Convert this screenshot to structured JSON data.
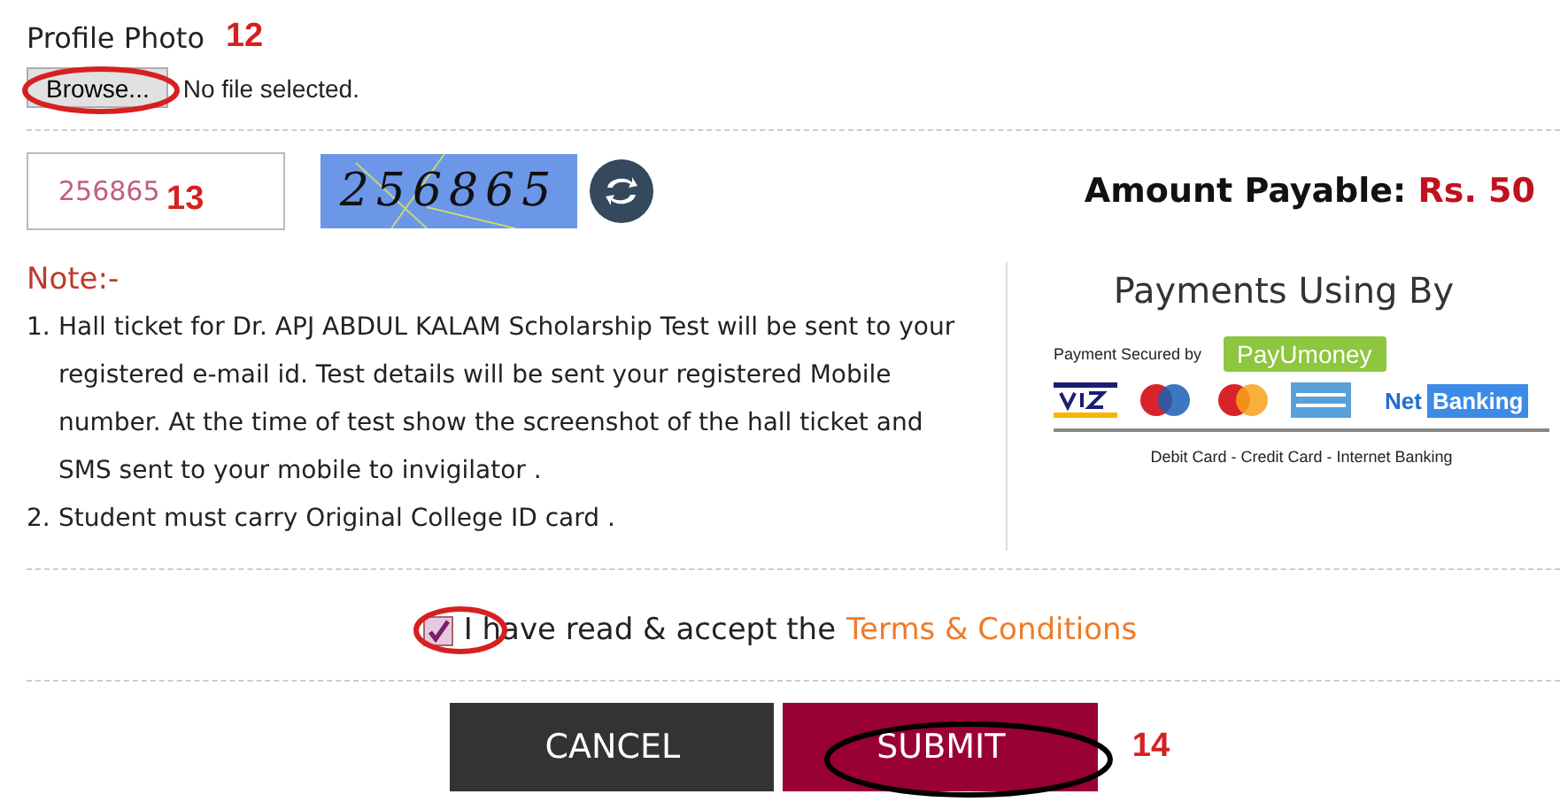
{
  "profile_photo": {
    "label": "Profile Photo",
    "button": "Browse...",
    "status": "No file selected."
  },
  "captcha": {
    "input_value": "256865",
    "image_text": "256865"
  },
  "amount": {
    "label": "Amount Payable:",
    "value": "Rs. 50"
  },
  "note": {
    "title": "Note:-",
    "items": [
      {
        "number": "1.",
        "text": "Hall ticket for Dr. APJ ABDUL KALAM Scholarship Test will be sent to your registered e-mail id. Test details will be sent your registered Mobile number. At the time of test show the screenshot of the hall ticket and SMS sent to your mobile to invigilator ."
      },
      {
        "number": "2.",
        "text": "Student must carry Original College ID card ."
      }
    ]
  },
  "payments": {
    "title": "Payments Using By",
    "secured_by": "Payment Secured by",
    "payu": "PayUmoney",
    "net": "Net",
    "banking": "Banking",
    "caption": "Debit Card - Credit Card - Internet Banking"
  },
  "terms": {
    "checked": true,
    "text": "I have read & accept the",
    "link": "Terms & Conditions"
  },
  "buttons": [
    {
      "kind": "cancel",
      "label": "CANCEL"
    },
    {
      "kind": "submit",
      "label": "SUBMIT"
    }
  ],
  "annotations": [
    "12",
    "13",
    "14"
  ]
}
